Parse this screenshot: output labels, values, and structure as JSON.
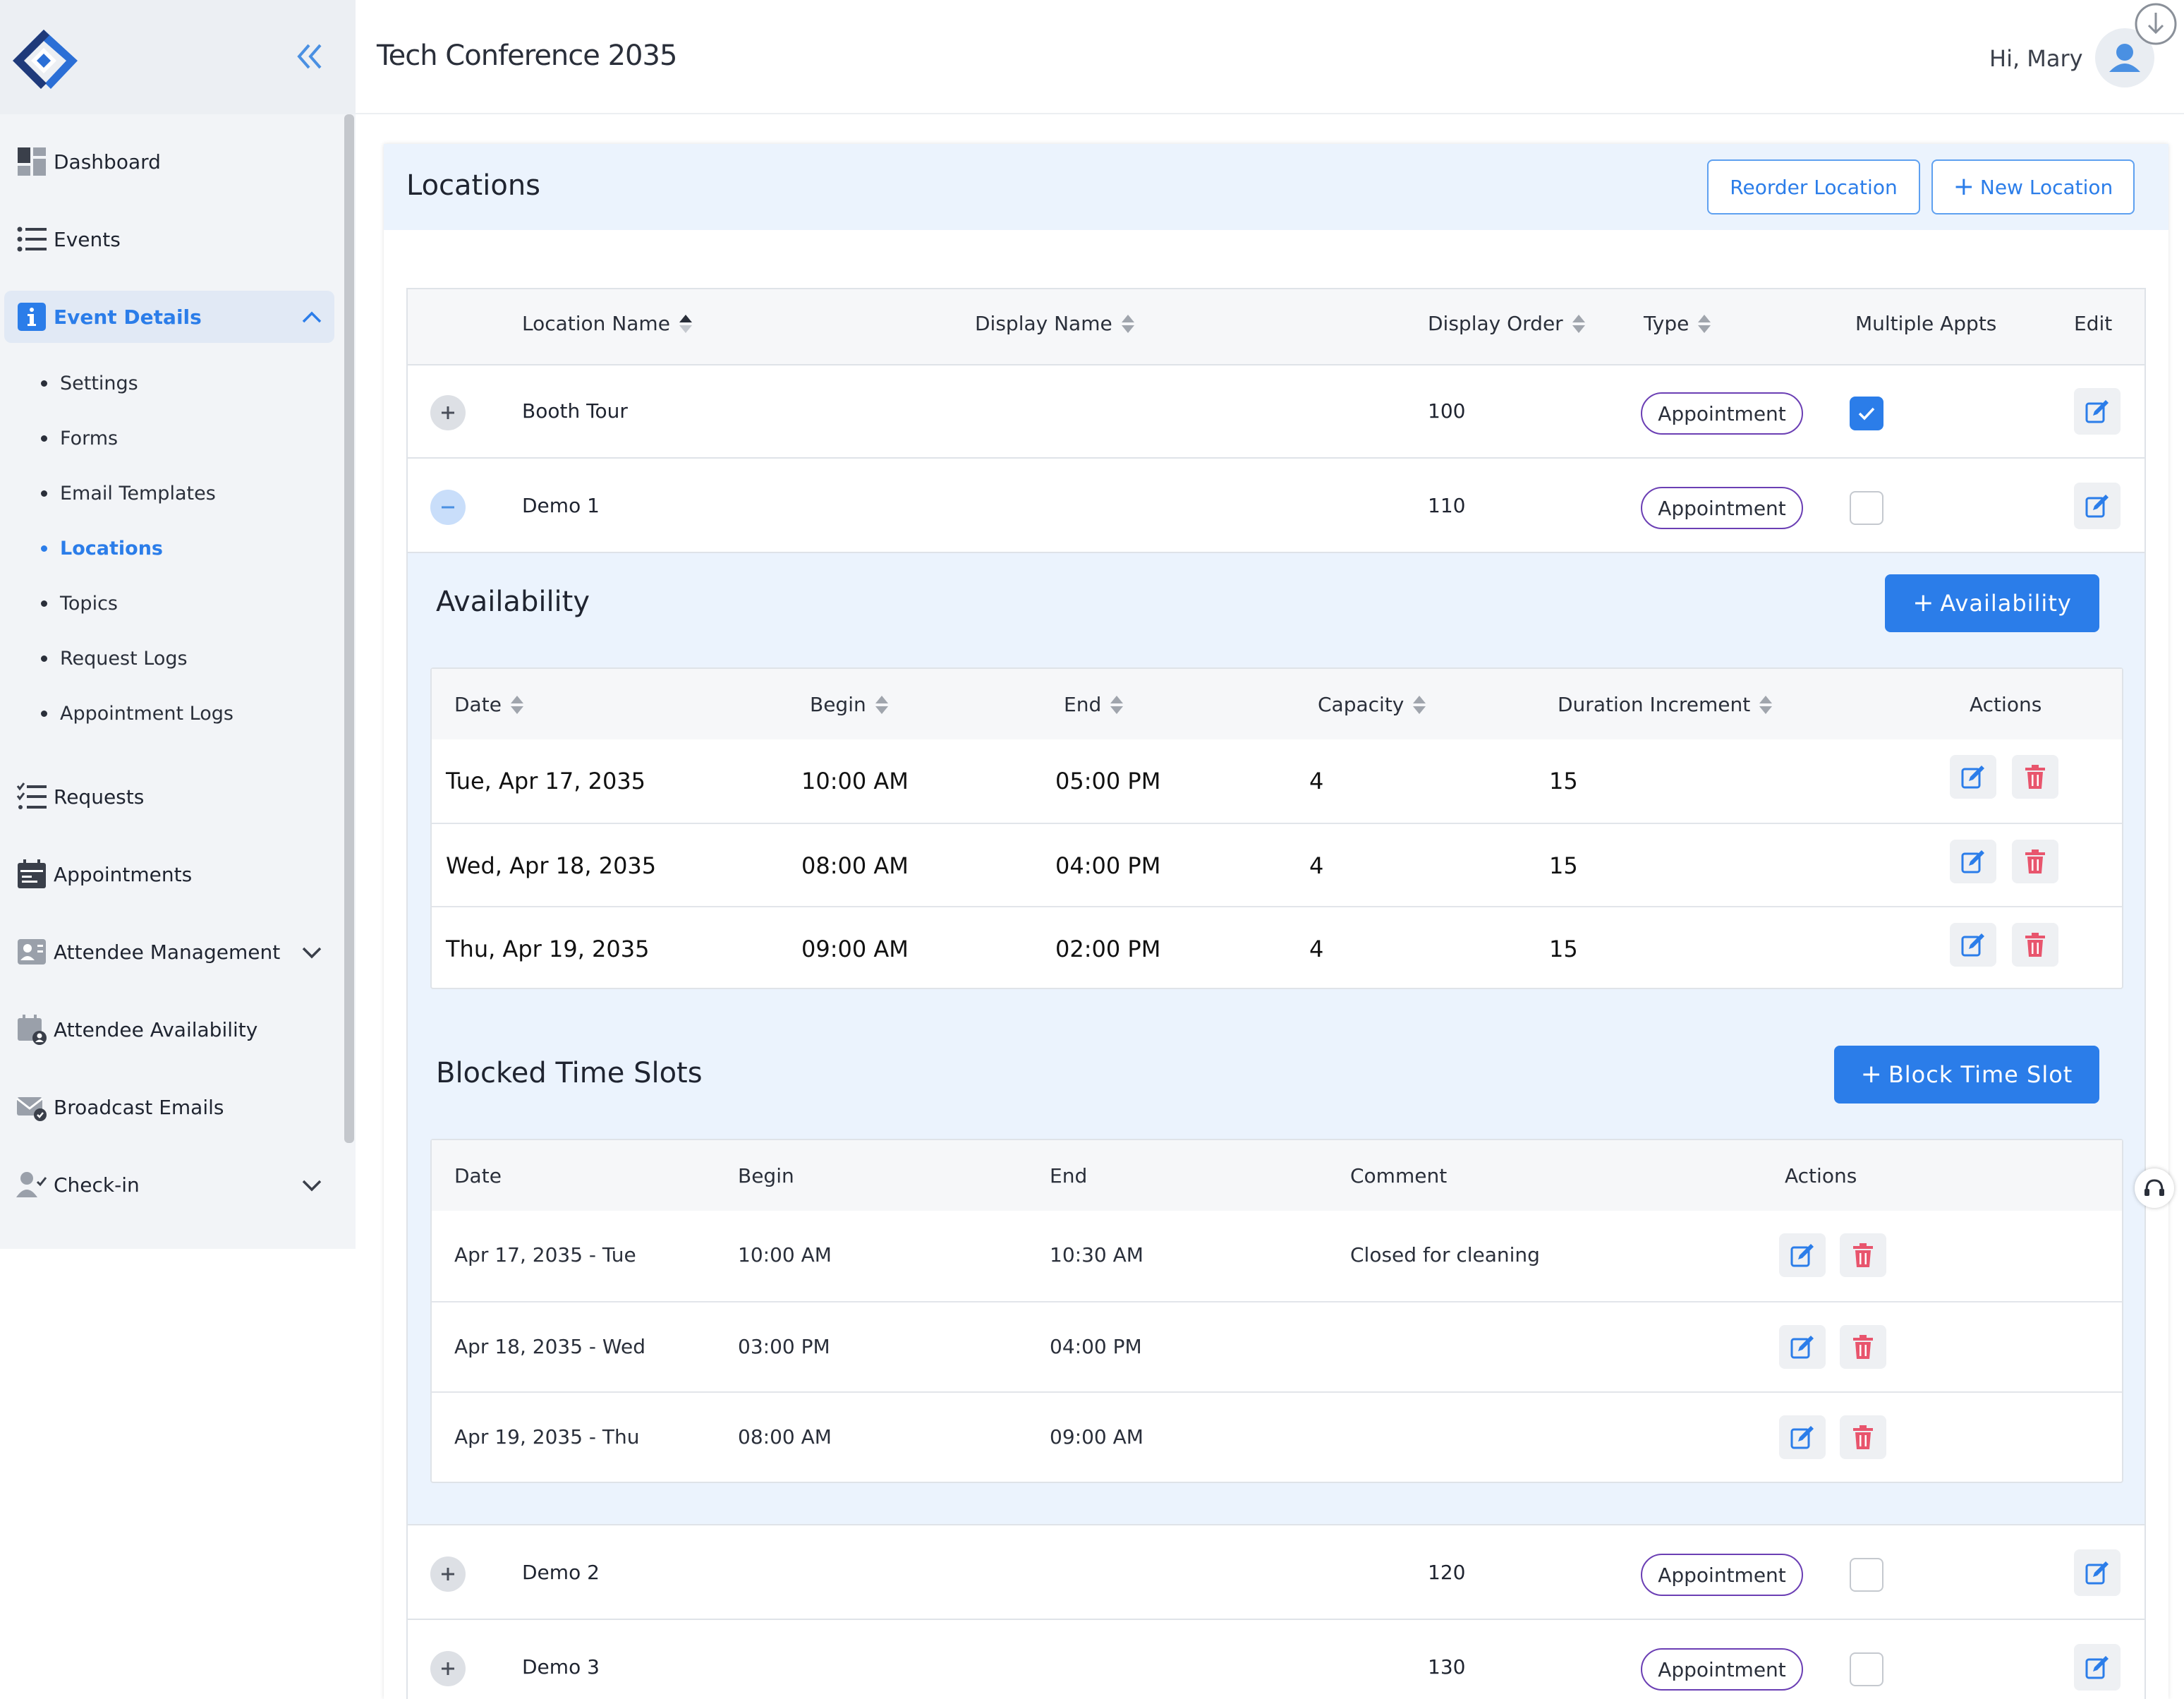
{
  "app": {
    "title": "Tech Conference 2035",
    "greeting": "Hi, Mary"
  },
  "sidebar": {
    "items": [
      {
        "label": "Dashboard",
        "icon": "dashboard-icon"
      },
      {
        "label": "Events",
        "icon": "list-icon"
      },
      {
        "label": "Event Details",
        "icon": "info-icon",
        "active": true,
        "expanded": true
      },
      {
        "label": "Requests",
        "icon": "checklist-icon"
      },
      {
        "label": "Appointments",
        "icon": "calendar-icon"
      },
      {
        "label": "Attendee Management",
        "icon": "id-card-icon"
      },
      {
        "label": "Attendee Availability",
        "icon": "calendar-user-icon"
      },
      {
        "label": "Broadcast Emails",
        "icon": "mail-check-icon"
      },
      {
        "label": "Check-in",
        "icon": "user-check-icon"
      }
    ],
    "sub_items": [
      {
        "label": "Settings"
      },
      {
        "label": "Forms"
      },
      {
        "label": "Email Templates"
      },
      {
        "label": "Locations",
        "active": true
      },
      {
        "label": "Topics"
      },
      {
        "label": "Request Logs"
      },
      {
        "label": "Appointment Logs"
      }
    ]
  },
  "locations": {
    "title": "Locations",
    "reorder_label": "Reorder Location",
    "new_label": "New Location",
    "columns": [
      "Location Name",
      "Display Name",
      "Display Order",
      "Type",
      "Multiple Appts",
      "Edit"
    ],
    "rows": [
      {
        "name": "Booth Tour",
        "display_name": "",
        "order": "100",
        "type": "Appointment",
        "multiple": true
      },
      {
        "name": "Demo 1",
        "display_name": "",
        "order": "110",
        "type": "Appointment",
        "multiple": false,
        "expanded": true
      },
      {
        "name": "Demo 2",
        "display_name": "",
        "order": "120",
        "type": "Appointment",
        "multiple": false
      },
      {
        "name": "Demo 3",
        "display_name": "",
        "order": "130",
        "type": "Appointment",
        "multiple": false
      }
    ]
  },
  "availability": {
    "title": "Availability",
    "add_label": "Availability",
    "columns": [
      "Date",
      "Begin",
      "End",
      "Capacity",
      "Duration Increment",
      "Actions"
    ],
    "rows": [
      {
        "date": "Tue, Apr 17, 2035",
        "begin": "10:00 AM",
        "end": "05:00 PM",
        "capacity": "4",
        "increment": "15"
      },
      {
        "date": "Wed, Apr 18, 2035",
        "begin": "08:00 AM",
        "end": "04:00 PM",
        "capacity": "4",
        "increment": "15"
      },
      {
        "date": "Thu, Apr 19, 2035",
        "begin": "09:00 AM",
        "end": "02:00 PM",
        "capacity": "4",
        "increment": "15"
      }
    ]
  },
  "blocked": {
    "title": "Blocked Time Slots",
    "add_label": "Block Time Slot",
    "columns": [
      "Date",
      "Begin",
      "End",
      "Comment",
      "Actions"
    ],
    "rows": [
      {
        "date": "Apr 17, 2035 - Tue",
        "begin": "10:00 AM",
        "end": "10:30 AM",
        "comment": "Closed for cleaning"
      },
      {
        "date": "Apr 18, 2035 - Wed",
        "begin": "03:00 PM",
        "end": "04:00 PM",
        "comment": ""
      },
      {
        "date": "Apr 19, 2035 - Thu",
        "begin": "08:00 AM",
        "end": "09:00 AM",
        "comment": ""
      }
    ]
  },
  "colors": {
    "accent": "#2b7de9",
    "pill_border": "#6b3fb4",
    "danger": "#e8556d"
  }
}
